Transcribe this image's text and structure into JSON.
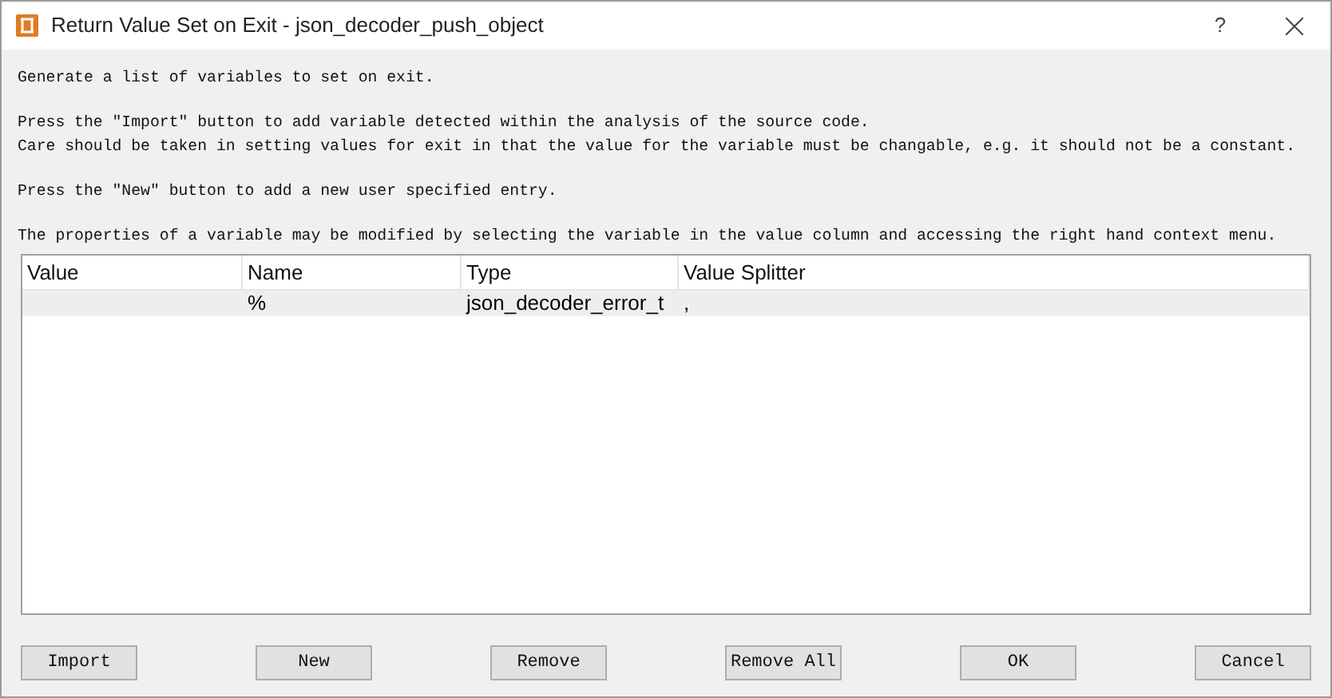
{
  "window": {
    "title": "Return Value Set on Exit - json_decoder_push_object",
    "help": "?"
  },
  "paragraphs": [
    [
      "Generate a list of variables to set on exit."
    ],
    [
      "Press the \"Import\" button to add variable detected within the analysis of the source code.",
      "Care should be taken in setting values for exit in that the value for the variable must be changable, e.g. it should not be a constant."
    ],
    [
      "Press the \"New\" button to add a new user specified entry."
    ],
    [
      "The properties of a variable may be modified by selecting the variable in the value column and accessing the right hand context menu."
    ]
  ],
  "table": {
    "columns": [
      "Value",
      "Name",
      "Type",
      "Value Splitter"
    ],
    "rows": [
      {
        "cells": [
          "",
          "%",
          "json_decoder_error_t",
          ","
        ],
        "selected": true
      }
    ]
  },
  "buttons": [
    "Import",
    "New",
    "Remove",
    "Remove All",
    "OK",
    "Cancel"
  ]
}
